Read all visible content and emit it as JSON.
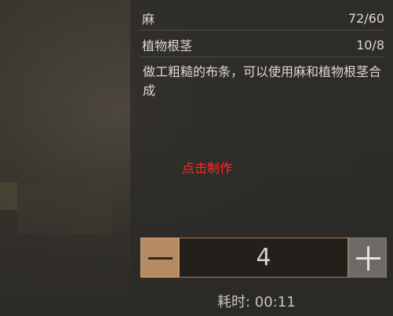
{
  "materials": [
    {
      "name": "麻",
      "count": "72/60"
    },
    {
      "name": "植物根茎",
      "count": "10/8"
    }
  ],
  "description": "做工粗糙的布条，可以使用麻和植物根茎合成",
  "craft_hint": "点击制作",
  "stepper": {
    "quantity": "4"
  },
  "time": {
    "label": "耗时: ",
    "value": "00:11"
  },
  "colors": {
    "hint_red": "#ff2a2a",
    "minus_button": "#b38a62",
    "plus_button": "#6e6b66"
  }
}
